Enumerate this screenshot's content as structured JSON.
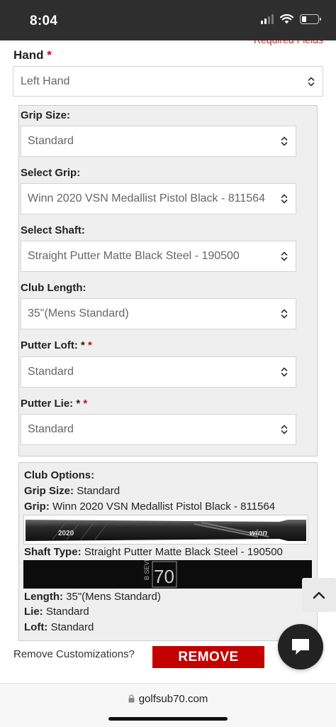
{
  "status_bar": {
    "time": "8:04",
    "battery_level": 0.3
  },
  "header": {
    "required_fields": "Required Fields"
  },
  "hand": {
    "label": "Hand",
    "required_marker": "*",
    "value": "Left Hand"
  },
  "fields": [
    {
      "label": "Grip Size:",
      "value": "Standard"
    },
    {
      "label": "Select Grip:",
      "value": "Winn 2020 VSN Medallist Pistol Black - 811564"
    },
    {
      "label": "Select Shaft:",
      "value": "Straight Putter Matte Black Steel - 190500"
    },
    {
      "label": "Club Length:",
      "value": "35\"(Mens Standard)"
    },
    {
      "label": "Putter Loft: *",
      "required_marker": "*",
      "value": "Standard"
    },
    {
      "label": "Putter Lie: *",
      "required_marker": "*",
      "value": "Standard"
    }
  ],
  "summary": {
    "title": "Club Options:",
    "grip_size_label": "Grip Size:",
    "grip_size_value": "Standard",
    "grip_label": "Grip:",
    "grip_value": "Winn 2020 VSN Medallist Pistol Black - 811564",
    "grip_image_text": "winn",
    "grip_image_text2": "2020",
    "shaft_label": "Shaft Type:",
    "shaft_value": "Straight Putter Matte Black Steel - 190500",
    "shaft_image_text": "B SEVENT",
    "shaft_image_text2": "70",
    "length_label": "Length:",
    "length_value": "35\"(Mens Standard)",
    "lie_label": "Lie:",
    "lie_value": "Standard",
    "loft_label": "Loft:",
    "loft_value": "Standard"
  },
  "remove": {
    "question": "Remove Customizations?",
    "button": "REMOVE"
  },
  "browser": {
    "url": "golfsub70.com"
  },
  "colors": {
    "status_bar": "#2e2e2e",
    "required": "#d0021b",
    "remove_button": "#c40000",
    "panel": "#efefef"
  },
  "icons": [
    "signal-icon",
    "wifi-icon",
    "battery-icon",
    "chevron-updown-icon",
    "chevron-up-icon",
    "chat-icon",
    "lock-icon"
  ]
}
